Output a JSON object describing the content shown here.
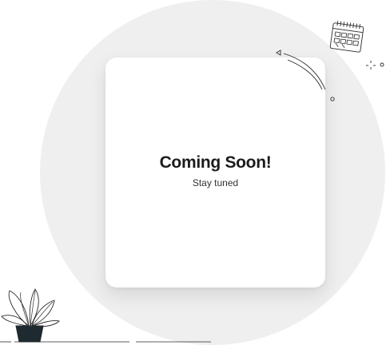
{
  "card": {
    "title": "Coming Soon!",
    "subtitle": "Stay tuned"
  },
  "decorations": {
    "calendar": "calendar-icon",
    "plant": "potted-plant-icon",
    "sparkle": "sparkle-icon",
    "arc": "decorative-arc-icon"
  },
  "colors": {
    "background_circle": "#efefef",
    "card": "#ffffff",
    "title_text": "#1c1c1c",
    "line_art": "#2a2a2a",
    "pot": "#1f2a30"
  }
}
